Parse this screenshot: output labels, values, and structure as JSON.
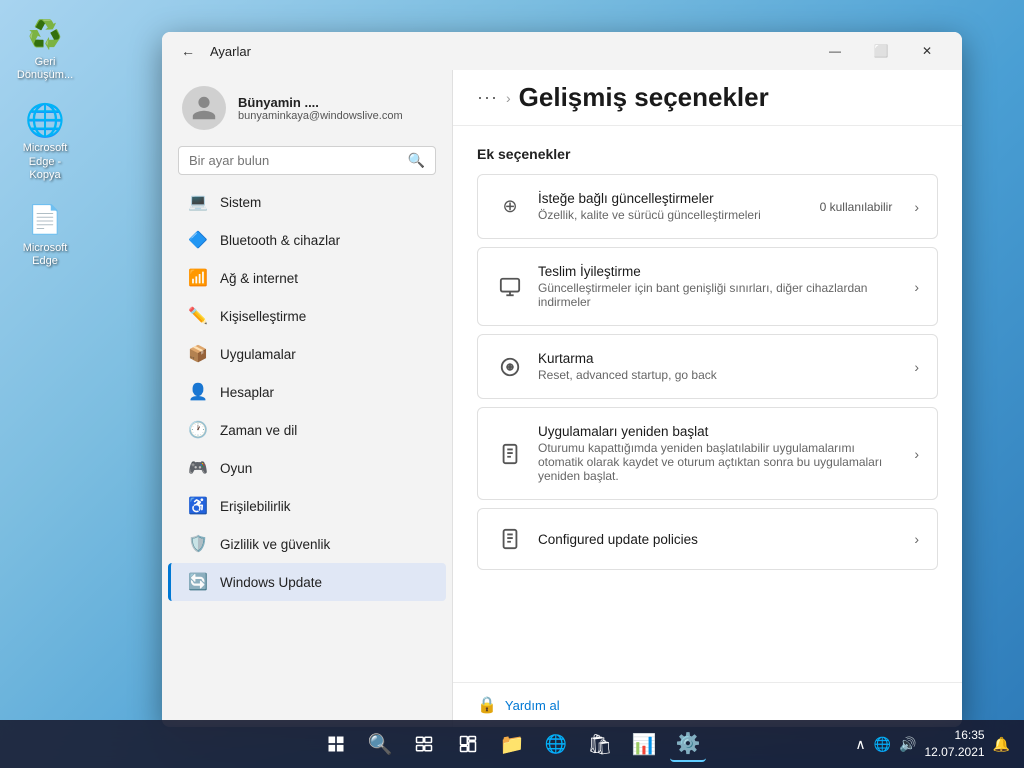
{
  "desktop": {
    "icons": [
      {
        "id": "recycle-bin",
        "emoji": "♻️",
        "label": "Geri\nDönüşüm..."
      },
      {
        "id": "edge-kopya",
        "emoji": "🌐",
        "label": "Microsoft\nEdge - Kopya"
      },
      {
        "id": "edge",
        "emoji": "📄",
        "label": "Microsoft\nEdge"
      }
    ]
  },
  "taskbar": {
    "start_icon": "⊞",
    "search_icon": "🔍",
    "taskview_icon": "❑",
    "widgets_icon": "▦",
    "explorer_icon": "📁",
    "edge_icon": "🌐",
    "store_icon": "🛍",
    "office_icon": "📊",
    "settings_icon": "⚙️",
    "clock": "16:35",
    "date": "12.07.2021",
    "sys_icons": [
      "∧",
      "□",
      "🔊"
    ]
  },
  "window": {
    "title": "Ayarlar",
    "back_label": "←",
    "minimize": "—",
    "maximize": "⬜",
    "close": "✕",
    "profile": {
      "name": "Bünyamin ....",
      "email": "bunyaminkaya@windowslive.com"
    },
    "search": {
      "placeholder": "Bir ayar bulun"
    },
    "nav_items": [
      {
        "id": "sistem",
        "icon": "💻",
        "label": "Sistem"
      },
      {
        "id": "bluetooth",
        "icon": "🔷",
        "label": "Bluetooth & cihazlar"
      },
      {
        "id": "ag-internet",
        "icon": "📶",
        "label": "Ağ & internet"
      },
      {
        "id": "kisiselleştirme",
        "icon": "✏️",
        "label": "Kişiselleştirme"
      },
      {
        "id": "uygulamalar",
        "icon": "📦",
        "label": "Uygulamalar"
      },
      {
        "id": "hesaplar",
        "icon": "👤",
        "label": "Hesaplar"
      },
      {
        "id": "zaman-dil",
        "icon": "🕐",
        "label": "Zaman ve dil"
      },
      {
        "id": "oyun",
        "icon": "🎮",
        "label": "Oyun"
      },
      {
        "id": "erisebilirlik",
        "icon": "♿",
        "label": "Erişilebilirlik"
      },
      {
        "id": "gizlilik",
        "icon": "🛡️",
        "label": "Gizlilik ve güvenlik"
      },
      {
        "id": "windows-update",
        "icon": "🔄",
        "label": "Windows Update",
        "active": true
      }
    ],
    "breadcrumb": {
      "dots": "···",
      "separator": "›",
      "title": "Gelişmiş seçenekler"
    },
    "section_title": "Ek seçenekler",
    "cards": [
      {
        "id": "istege-bagli",
        "icon": "⊕",
        "title": "İsteğe bağlı güncelleştirmeler",
        "subtitle": "Özellik, kalite ve sürücü güncelleştirmeleri",
        "badge": "0 kullanılabilir",
        "has_chevron": true
      },
      {
        "id": "teslim-iyilestirme",
        "icon": "🖥",
        "title": "Teslim İyileştirme",
        "subtitle": "Güncelleştirmeler için bant genişliği sınırları, diğer cihazlardan indirmeler",
        "badge": "",
        "has_chevron": true
      },
      {
        "id": "kurtarma",
        "icon": "🔑",
        "title": "Kurtarma",
        "subtitle": "Reset, advanced startup, go back",
        "badge": "",
        "has_chevron": true
      },
      {
        "id": "uygulamalari-yeniden",
        "icon": "💾",
        "title": "Uygulamaları yeniden başlat",
        "subtitle": "Oturumu kapattığımda yeniden başlatılabilir uygulamalarımı otomatik olarak kaydet ve oturum açtıktan sonra bu uygulamaları yeniden başlat.",
        "badge": "",
        "has_chevron": true
      },
      {
        "id": "configured-policies",
        "icon": "💾",
        "title": "Configured update policies",
        "subtitle": "",
        "badge": "",
        "has_chevron": true
      }
    ],
    "help_link": "Yardım al"
  }
}
